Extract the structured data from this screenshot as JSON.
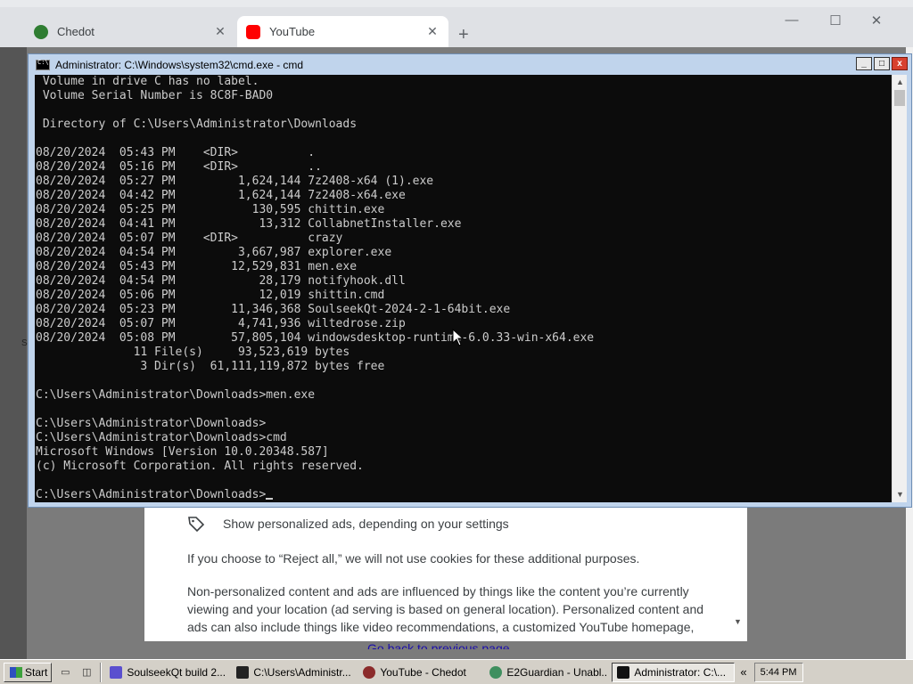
{
  "browser": {
    "tabs": [
      {
        "title": "Chedot",
        "favicon": "chedot-icon",
        "color": "#3a8f3a"
      },
      {
        "title": "YouTube",
        "favicon": "youtube-icon",
        "color": "#ff0000"
      }
    ],
    "new_tab": "+",
    "window_controls": {
      "minimize": "—",
      "maximize": "☐",
      "close": "✕"
    },
    "stray_label": "S"
  },
  "consent": {
    "ad_row": "Show personalized ads, depending on your settings",
    "reject_text": "If you choose to “Reject all,” we will not use cookies for these additional purposes.",
    "nonpersonal_text": "Non-personalized content and ads are influenced by things like the content you’re currently viewing and your location (ad serving is based on general location). Personalized content and ads can also include things like video recommendations, a customized YouTube homepage,",
    "go_back": "Go back to previous page"
  },
  "cmd": {
    "title": "Administrator: C:\\Windows\\system32\\cmd.exe - cmd",
    "buttons": {
      "minimize": "_",
      "maximize": "□",
      "close": "x"
    },
    "lines": [
      " Volume in drive C has no label.",
      " Volume Serial Number is 8C8F-BAD0",
      "",
      " Directory of C:\\Users\\Administrator\\Downloads",
      "",
      "08/20/2024  05:43 PM    <DIR>          .",
      "08/20/2024  05:16 PM    <DIR>          ..",
      "08/20/2024  05:27 PM         1,624,144 7z2408-x64 (1).exe",
      "08/20/2024  04:42 PM         1,624,144 7z2408-x64.exe",
      "08/20/2024  05:25 PM           130,595 chittin.exe",
      "08/20/2024  04:41 PM            13,312 CollabnetInstaller.exe",
      "08/20/2024  05:07 PM    <DIR>          crazy",
      "08/20/2024  04:54 PM         3,667,987 explorer.exe",
      "08/20/2024  05:43 PM        12,529,831 men.exe",
      "08/20/2024  04:54 PM            28,179 notifyhook.dll",
      "08/20/2024  05:06 PM            12,019 shittin.cmd",
      "08/20/2024  05:23 PM        11,346,368 SoulseekQt-2024-2-1-64bit.exe",
      "08/20/2024  05:07 PM         4,741,936 wiltedrose.zip",
      "08/20/2024  05:08 PM        57,805,104 windowsdesktop-runtime-6.0.33-win-x64.exe",
      "              11 File(s)     93,523,619 bytes",
      "               3 Dir(s)  61,111,119,872 bytes free",
      "",
      "C:\\Users\\Administrator\\Downloads>men.exe",
      "",
      "C:\\Users\\Administrator\\Downloads>",
      "C:\\Users\\Administrator\\Downloads>cmd",
      "Microsoft Windows [Version 10.0.20348.587]",
      "(c) Microsoft Corporation. All rights reserved.",
      "",
      "C:\\Users\\Administrator\\Downloads>"
    ]
  },
  "taskbar": {
    "start": "Start",
    "tasks": [
      {
        "label": "SoulseekQt build 2...",
        "icon": "soulseek-icon",
        "color": "#5a4fcf",
        "active": false
      },
      {
        "label": "C:\\Users\\Administr...",
        "icon": "7zip-icon",
        "color": "#222222",
        "active": false
      },
      {
        "label": "YouTube - Chedot",
        "icon": "chedot-icon",
        "color": "#8b2b2b",
        "active": false
      },
      {
        "label": "E2Guardian - Unabl...",
        "icon": "e2guardian-icon",
        "color": "#3f8f5f",
        "active": false
      },
      {
        "label": "Administrator: C:\\...",
        "icon": "cmd-icon",
        "color": "#111111",
        "active": true
      }
    ],
    "tray_arrow": "«",
    "clock": "5:44 PM"
  }
}
